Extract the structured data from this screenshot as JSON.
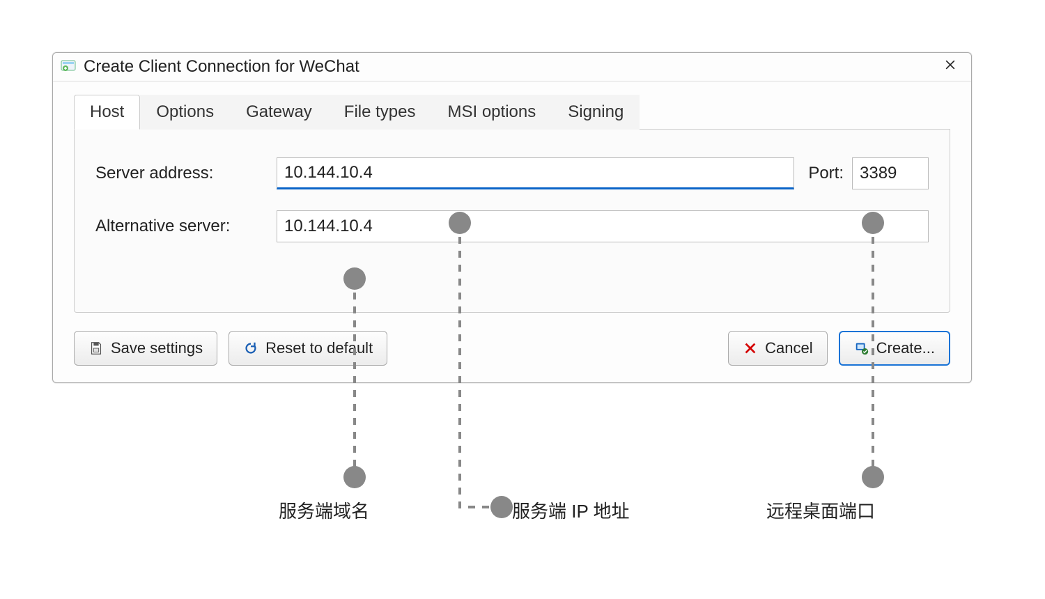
{
  "window": {
    "title": "Create Client Connection for WeChat"
  },
  "tabs": {
    "items": [
      {
        "label": "Host",
        "active": true
      },
      {
        "label": "Options",
        "active": false
      },
      {
        "label": "Gateway",
        "active": false
      },
      {
        "label": "File types",
        "active": false
      },
      {
        "label": "MSI options",
        "active": false
      },
      {
        "label": "Signing",
        "active": false
      }
    ]
  },
  "fields": {
    "server_address_label": "Server address:",
    "server_address_value": "10.144.10.4",
    "port_label": "Port:",
    "port_value": "3389",
    "alternative_server_label": "Alternative server:",
    "alternative_server_value": "10.144.10.4"
  },
  "buttons": {
    "save_settings": "Save settings",
    "reset_to_default": "Reset to default",
    "cancel": "Cancel",
    "create": "Create..."
  },
  "annotations": {
    "alt_server": "服务端域名",
    "server_ip": "服务端 IP 地址",
    "port": "远程桌面端口"
  },
  "colors": {
    "focus_underline": "#0a64c8",
    "primary_border": "#1a73d6",
    "cancel_x": "#d40000",
    "reset_arrow": "#1a5fb4",
    "create_icon_green": "#2e7d32",
    "create_icon_blue": "#1565c0"
  }
}
